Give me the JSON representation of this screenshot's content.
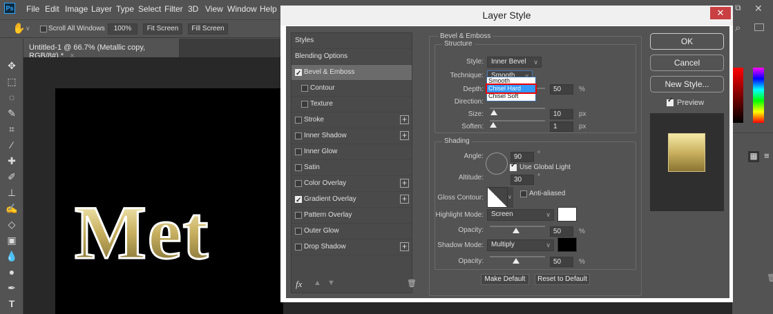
{
  "app": {
    "logo": "Ps",
    "menu": [
      "File",
      "Edit",
      "Image",
      "Layer",
      "Type",
      "Select",
      "Filter",
      "3D",
      "View",
      "Window",
      "Help"
    ]
  },
  "options": {
    "scroll_all": "Scroll All Windows",
    "zoom100": "100%",
    "fit": "Fit Screen",
    "fill": "Fill Screen"
  },
  "document": {
    "tab": "Untitled-1 @ 66.7% (Metallic copy, RGB/8#) *",
    "canvas_text": "Met"
  },
  "dialog": {
    "title": "Layer Style",
    "styles": [
      {
        "label": "Styles",
        "check": null,
        "plus": false
      },
      {
        "label": "Blending Options",
        "check": null,
        "plus": false
      },
      {
        "label": "Bevel & Emboss",
        "check": true,
        "plus": false,
        "selected": true
      },
      {
        "label": "Contour",
        "check": false,
        "plus": false,
        "sub": true
      },
      {
        "label": "Texture",
        "check": false,
        "plus": false,
        "sub": true
      },
      {
        "label": "Stroke",
        "check": false,
        "plus": true
      },
      {
        "label": "Inner Shadow",
        "check": false,
        "plus": true
      },
      {
        "label": "Inner Glow",
        "check": false,
        "plus": false
      },
      {
        "label": "Satin",
        "check": false,
        "plus": false
      },
      {
        "label": "Color Overlay",
        "check": false,
        "plus": true
      },
      {
        "label": "Gradient Overlay",
        "check": true,
        "plus": true
      },
      {
        "label": "Pattern Overlay",
        "check": false,
        "plus": false
      },
      {
        "label": "Outer Glow",
        "check": false,
        "plus": false
      },
      {
        "label": "Drop Shadow",
        "check": false,
        "plus": true
      }
    ],
    "fx": "fx",
    "bevel": {
      "title": "Bevel & Emboss",
      "structure": "Structure",
      "style_label": "Style:",
      "style": "Inner Bevel",
      "technique_label": "Technique:",
      "technique": "Smooth",
      "technique_options": [
        "Smooth",
        "Chisel Hard",
        "Chisel Soft"
      ],
      "depth_label": "Depth:",
      "depth": "50",
      "depth_unit": "%",
      "direction_label": "Direction:",
      "size_label": "Size:",
      "size": "10",
      "size_unit": "px",
      "soften_label": "Soften:",
      "soften": "1",
      "soften_unit": "px"
    },
    "shading": {
      "title": "Shading",
      "angle_label": "Angle:",
      "angle": "90",
      "deg": "°",
      "global_light": "Use Global Light",
      "altitude_label": "Altitude:",
      "altitude": "30",
      "gloss_label": "Gloss Contour:",
      "anti_aliased": "Anti-aliased",
      "highlight_label": "Highlight Mode:",
      "highlight_mode": "Screen",
      "highlight_color": "#ffffff",
      "opacity_label": "Opacity:",
      "highlight_opacity": "50",
      "pct": "%",
      "shadow_label": "Shadow Mode:",
      "shadow_mode": "Multiply",
      "shadow_color": "#000000",
      "shadow_opacity": "50"
    },
    "make_default": "Make Default",
    "reset_default": "Reset to Default",
    "ok": "OK",
    "cancel": "Cancel",
    "new_style": "New Style...",
    "preview": "Preview"
  }
}
